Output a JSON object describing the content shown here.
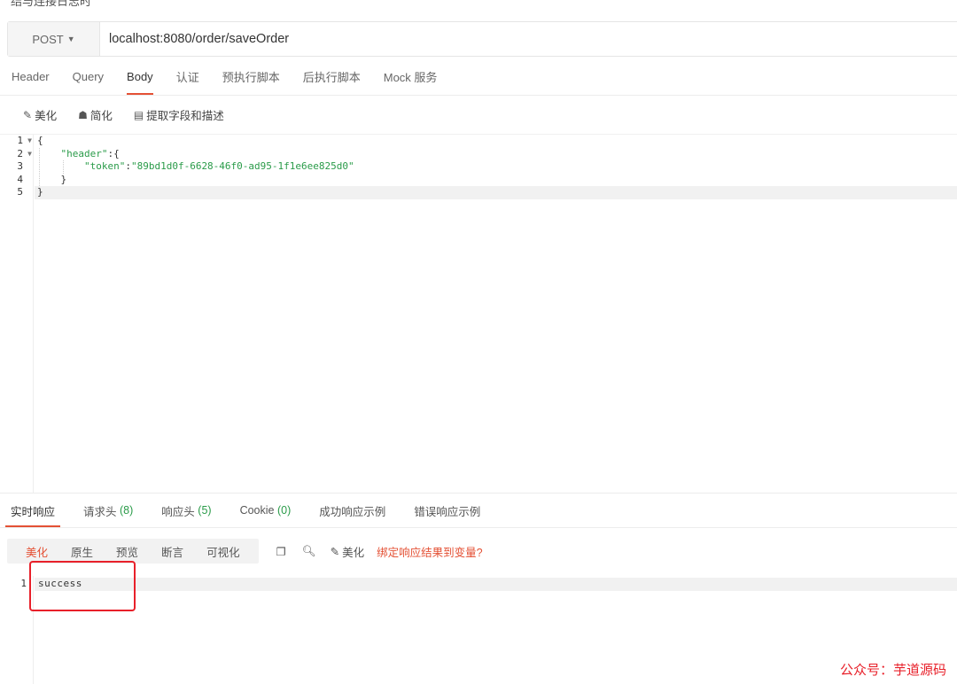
{
  "top_cut_text": "结与连接日志时",
  "request": {
    "method": "POST",
    "url": "localhost:8080/order/saveOrder"
  },
  "request_tabs": [
    {
      "label": "Header",
      "active": false
    },
    {
      "label": "Query",
      "active": false
    },
    {
      "label": "Body",
      "active": true
    },
    {
      "label": "认证",
      "active": false
    },
    {
      "label": "预执行脚本",
      "active": false
    },
    {
      "label": "后执行脚本",
      "active": false
    },
    {
      "label": "Mock 服务",
      "active": false
    }
  ],
  "body_toolbar": {
    "beautify": "美化",
    "simplify": "简化",
    "extract": "提取字段和描述"
  },
  "editor": {
    "line_numbers": [
      "1",
      "2",
      "3",
      "4",
      "5"
    ],
    "line1": "{",
    "line2_key": "\"header\"",
    "line2_rest": ":{",
    "line3_key": "\"token\"",
    "line3_colon": ":",
    "line3_value": "\"89bd1d0f-6628-46f0-ad95-1f1e6ee825d0\"",
    "line4": "}",
    "line5": "}"
  },
  "response_tabs": {
    "realtime": "实时响应",
    "req_headers": "请求头",
    "req_headers_count": "(8)",
    "res_headers": "响应头",
    "res_headers_count": "(5)",
    "cookie": "Cookie",
    "cookie_count": "(0)",
    "success_example": "成功响应示例",
    "error_example": "错误响应示例"
  },
  "response_toolbar": {
    "views": [
      "美化",
      "原生",
      "预览",
      "断言",
      "可视化"
    ],
    "beautify": "美化",
    "bind_link": "绑定响应结果到变量?"
  },
  "response": {
    "line_number": "1",
    "text": "success"
  },
  "watermark": "公众号：芋道源码",
  "colors": {
    "accent": "#e45135",
    "json_green": "#2a9b49",
    "highlight_red": "#e8202a"
  }
}
